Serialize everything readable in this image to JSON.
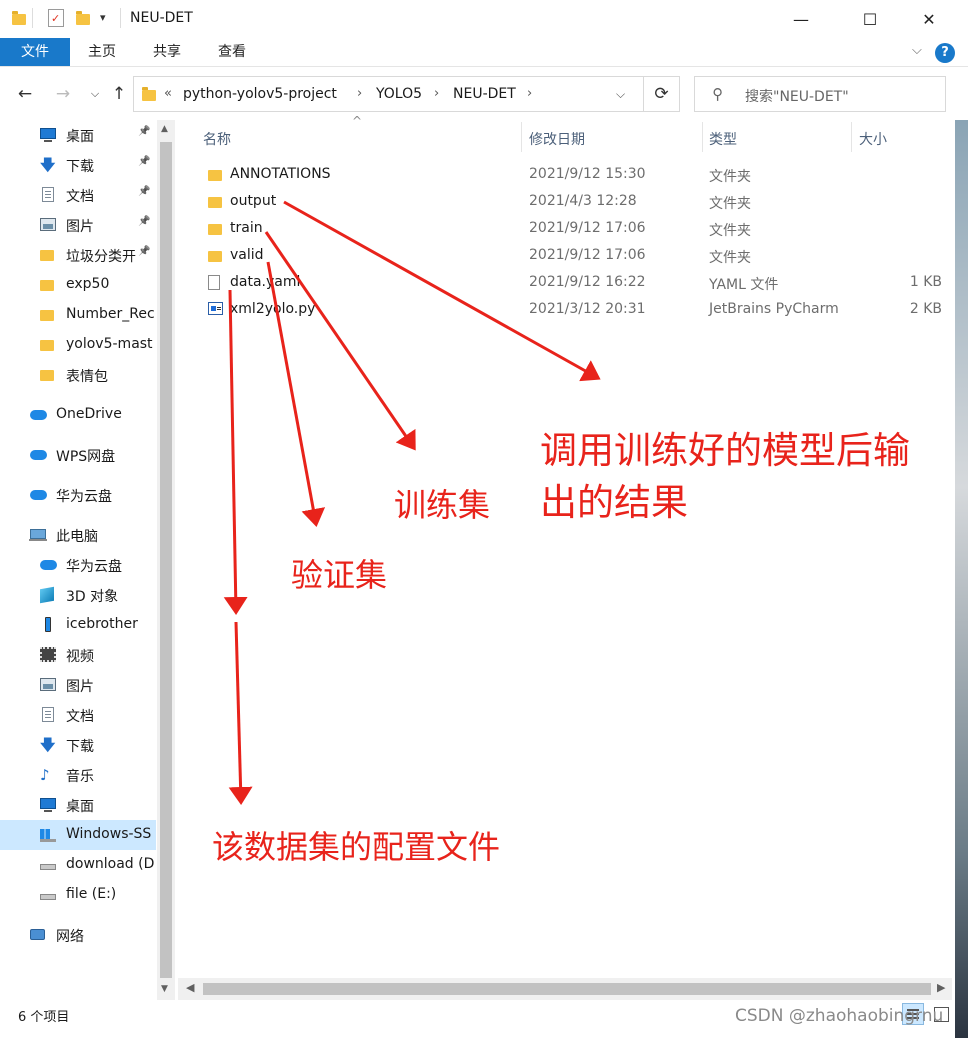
{
  "window": {
    "title": "NEU-DET",
    "controls": {
      "minimize": "—",
      "maximize": "☐",
      "close": "✕"
    }
  },
  "ribbon": {
    "tabs": [
      "文件",
      "主页",
      "共享",
      "查看"
    ],
    "help": "?"
  },
  "address": {
    "prefix": "«",
    "crumbs": [
      "python-yolov5-project",
      "YOLO5",
      "NEU-DET"
    ],
    "search_placeholder": "搜索\"NEU-DET\""
  },
  "nav": {
    "items": [
      {
        "label": "桌面",
        "icon": "desktop-icon",
        "pinned": true
      },
      {
        "label": "下载",
        "icon": "download-icon",
        "pinned": true
      },
      {
        "label": "文档",
        "icon": "document-icon",
        "pinned": true
      },
      {
        "label": "图片",
        "icon": "pictures-icon",
        "pinned": true
      },
      {
        "label": "垃圾分类开",
        "icon": "folder-icon",
        "pinned": true
      },
      {
        "label": "exp50",
        "icon": "folder-icon"
      },
      {
        "label": "Number_Rec",
        "icon": "folder-icon"
      },
      {
        "label": "yolov5-mast",
        "icon": "folder-icon"
      },
      {
        "label": "表情包",
        "icon": "folder-icon"
      },
      {
        "label": "OneDrive",
        "icon": "cloud-icon"
      },
      {
        "label": "WPS网盘",
        "icon": "cloud-icon"
      },
      {
        "label": "华为云盘",
        "icon": "cloud-icon"
      },
      {
        "label": "此电脑",
        "icon": "computer-icon"
      },
      {
        "label": "华为云盘",
        "icon": "cloud-icon"
      },
      {
        "label": "3D 对象",
        "icon": "3d-objects-icon"
      },
      {
        "label": "icebrother",
        "icon": "phone-icon"
      },
      {
        "label": "视频",
        "icon": "video-icon"
      },
      {
        "label": "图片",
        "icon": "pictures-icon"
      },
      {
        "label": "文档",
        "icon": "document-icon"
      },
      {
        "label": "下载",
        "icon": "download-icon"
      },
      {
        "label": "音乐",
        "icon": "music-icon"
      },
      {
        "label": "桌面",
        "icon": "desktop-icon"
      },
      {
        "label": "Windows-SS",
        "icon": "windows-drive-icon",
        "selected": true
      },
      {
        "label": "download (D",
        "icon": "drive-icon"
      },
      {
        "label": "file (E:)",
        "icon": "drive-icon"
      },
      {
        "label": "网络",
        "icon": "network-icon"
      }
    ]
  },
  "columns": {
    "name": "名称",
    "date": "修改日期",
    "type": "类型",
    "size": "大小"
  },
  "files": [
    {
      "name": "ANNOTATIONS",
      "date": "2021/9/12 15:30",
      "type": "文件夹",
      "size": "",
      "icon": "folder-icon"
    },
    {
      "name": "output",
      "date": "2021/4/3 12:28",
      "type": "文件夹",
      "size": "",
      "icon": "folder-icon"
    },
    {
      "name": "train",
      "date": "2021/9/12 17:06",
      "type": "文件夹",
      "size": "",
      "icon": "folder-icon"
    },
    {
      "name": "valid",
      "date": "2021/9/12 17:06",
      "type": "文件夹",
      "size": "",
      "icon": "folder-icon"
    },
    {
      "name": "data.yaml",
      "date": "2021/9/12 16:22",
      "type": "YAML 文件",
      "size": "1 KB",
      "icon": "file-icon"
    },
    {
      "name": "xml2yolo.py",
      "date": "2021/3/12 20:31",
      "type": "JetBrains PyCharm",
      "size": "2 KB",
      "icon": "python-file-icon"
    }
  ],
  "status": {
    "count": "6 个项目"
  },
  "annotations": {
    "output_line1": "调用训练好的模型后输",
    "output_line2": "出的结果",
    "train": "训练集",
    "valid": "验证集",
    "data": "该数据集的配置文件"
  },
  "watermark": "CSDN @zhaohaobingrnu",
  "colors": {
    "accent": "#1979ca",
    "annotation": "#e8231b",
    "selected": "#cce8ff"
  }
}
